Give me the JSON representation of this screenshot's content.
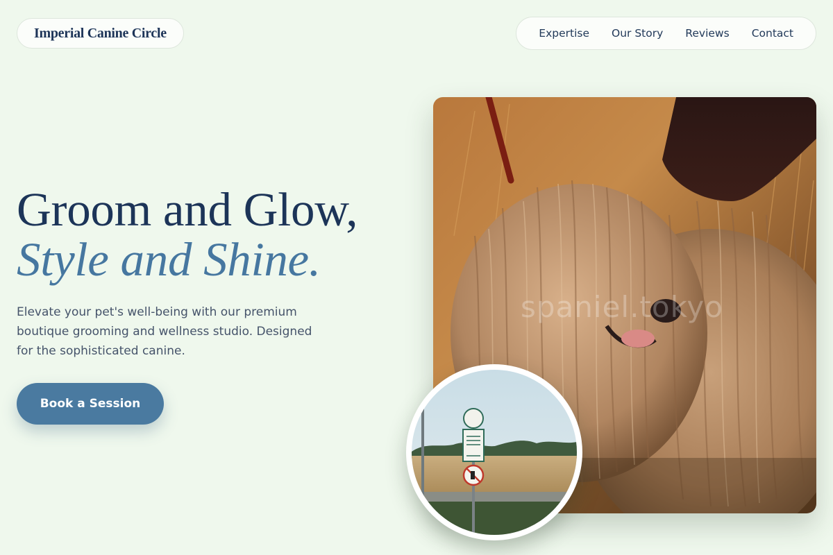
{
  "header": {
    "brand": "Imperial Canine Circle",
    "nav": [
      {
        "label": "Expertise"
      },
      {
        "label": "Our Story"
      },
      {
        "label": "Reviews"
      },
      {
        "label": "Contact"
      }
    ]
  },
  "hero": {
    "headline_line1": "Groom and Glow,",
    "headline_line2": "Style and Shine.",
    "description": "Elevate your pet's well-being with our premium boutique grooming and wellness studio. Designed for the sophisticated canine.",
    "cta_label": "Book a Session"
  },
  "media": {
    "main_photo_watermark": "spaniel.tokyo"
  },
  "colors": {
    "background": "#eff8ed",
    "navy": "#1c3458",
    "accent_blue": "#4a7aa0"
  }
}
